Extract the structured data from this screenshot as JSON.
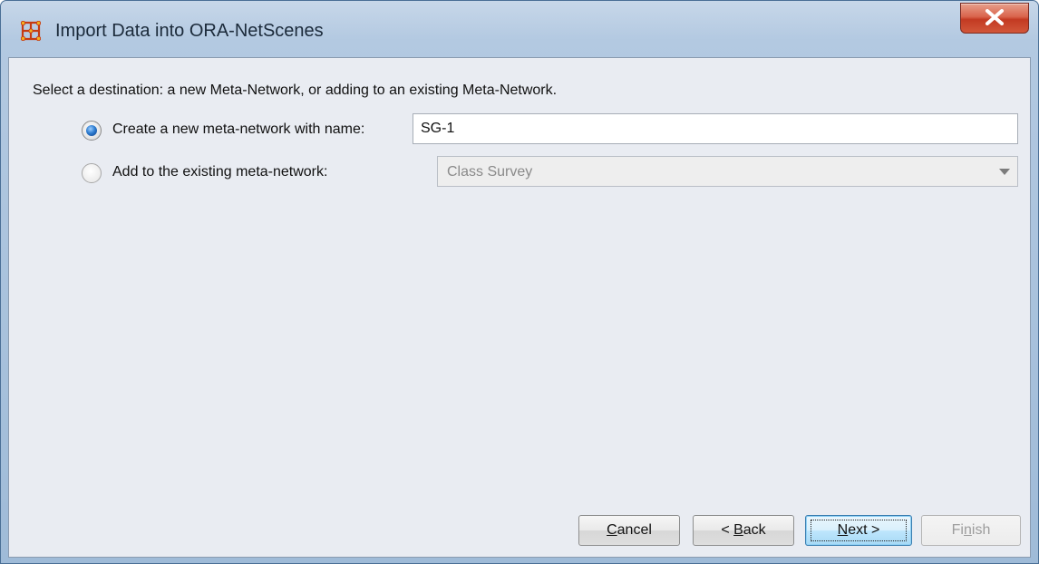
{
  "window": {
    "title": "Import Data into ORA-NetScenes",
    "app_icon": "ora-network-icon",
    "close_icon": "close-icon"
  },
  "instruction": "Select a destination: a new Meta-Network, or adding to an existing Meta-Network.",
  "options": {
    "new_network": {
      "label": "Create a new meta-network with name:",
      "selected": true,
      "value": "SG-1"
    },
    "existing_network": {
      "label": "Add to the existing meta-network:",
      "selected": false,
      "selected_value": "Class Survey"
    }
  },
  "buttons": {
    "cancel": {
      "label": "Cancel",
      "mnemonic": "C",
      "rest": "ancel"
    },
    "back": {
      "pre": "< ",
      "mnemonic": "B",
      "rest": "ack"
    },
    "next": {
      "mnemonic": "N",
      "rest": "ext >"
    },
    "finish": {
      "pre": "Fi",
      "mnemonic": "n",
      "rest": "ish"
    }
  },
  "colors": {
    "title_bar": "#b3c9e1",
    "close_button": "#c33a22",
    "content_bg": "#e9ecf2",
    "radio_selected": "#2f7dd1"
  }
}
